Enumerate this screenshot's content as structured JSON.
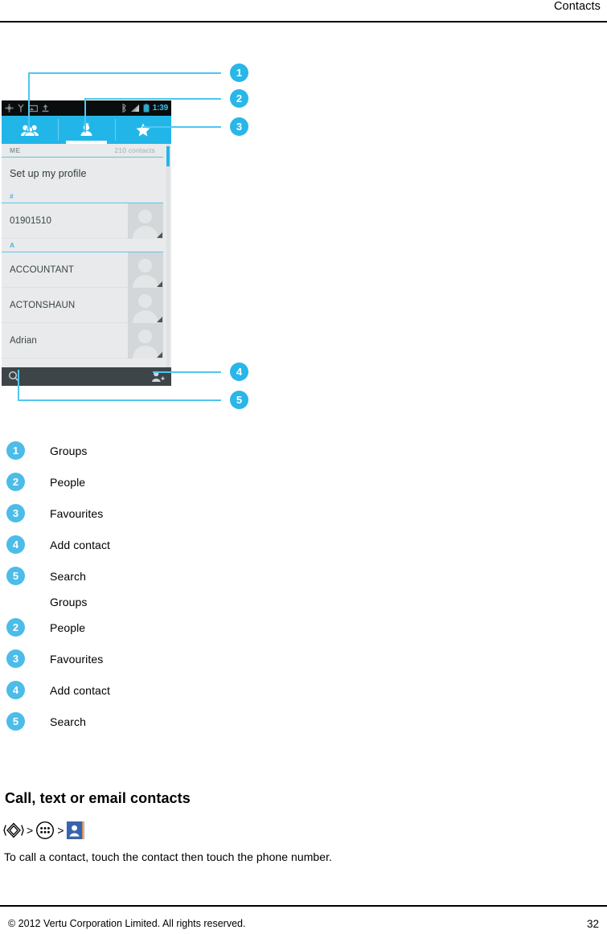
{
  "page": {
    "header_title": "Contacts",
    "page_number": "32",
    "footer_text": "© 2012 Vertu Corporation Limited. All rights reserved."
  },
  "phone": {
    "status_bar": {
      "left_icons": [
        "sync-icon",
        "location-icon",
        "screenshot-icon",
        "upload-icon"
      ],
      "right_icons": [
        "bluetooth-icon",
        "signal-icon",
        "battery-icon"
      ],
      "clock": "1:39"
    },
    "tabs": [
      {
        "name": "groups",
        "icon": "groups-icon",
        "active": false
      },
      {
        "name": "people",
        "icon": "person-icon",
        "active": true
      },
      {
        "name": "favourites",
        "icon": "star-icon",
        "active": false
      }
    ],
    "list": {
      "me_header": "ME",
      "contacts_count": "210 contacts",
      "profile_row": "Set up my profile",
      "sections": [
        {
          "letter": "#",
          "rows": [
            "01901510"
          ]
        },
        {
          "letter": "A",
          "rows": [
            "ACCOUNTANT",
            "ACTONSHAUN",
            "Adrian"
          ]
        }
      ]
    },
    "bottom_bar": {
      "search_icon": "search-icon",
      "add_contact_icon": "add-contact-icon"
    }
  },
  "callouts": [
    {
      "number": "1",
      "target": "groups-tab"
    },
    {
      "number": "2",
      "target": "people-tab"
    },
    {
      "number": "3",
      "target": "favourites-tab"
    },
    {
      "number": "4",
      "target": "add-contact-button"
    },
    {
      "number": "5",
      "target": "search-button"
    }
  ],
  "legend_primary": [
    {
      "number": "1",
      "label": "Groups"
    },
    {
      "number": "2",
      "label": "People"
    },
    {
      "number": "3",
      "label": "Favourites"
    },
    {
      "number": "4",
      "label": "Add contact"
    },
    {
      "number": "5",
      "label": "Search"
    }
  ],
  "legend_secondary": [
    {
      "number": "",
      "label": "Groups"
    },
    {
      "number": "2",
      "label": "People"
    },
    {
      "number": "3",
      "label": "Favourites"
    },
    {
      "number": "4",
      "label": "Add contact"
    },
    {
      "number": "5",
      "label": "Search"
    }
  ],
  "section": {
    "title": "Call, text or email contacts",
    "breadcrumb": {
      "home_icon": "vertu-home-icon",
      "separator": ">",
      "apps_icon": "apps-grid-icon",
      "app_icon": "contacts-app-icon"
    },
    "body": "To call a contact, touch the contact then touch the phone number."
  },
  "colors": {
    "accent": "#22b6e8",
    "badge": "#29b6e8",
    "legend_badge": "#4cbce8",
    "status_bar": "#0a0d0e",
    "bottom_bar": "#3e4548",
    "list_bg": "#e8eaeb"
  }
}
